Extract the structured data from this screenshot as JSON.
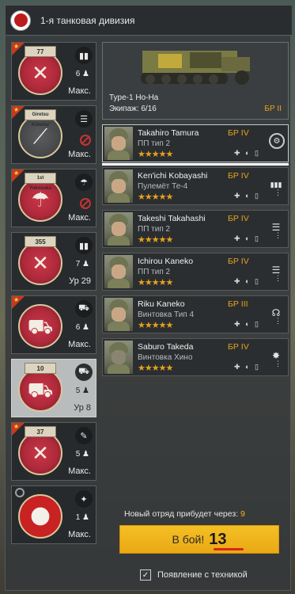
{
  "header": {
    "title": "1-я танковая дивизия"
  },
  "squads": [
    {
      "banner": "77",
      "count": "6",
      "status": "Макс.",
      "type_icon": "grenade-icon"
    },
    {
      "banner": "Giretsu Kūteitai",
      "count": "",
      "status": "Макс.",
      "type_icon": "list-icon",
      "locked": true
    },
    {
      "banner": "1st Yokosuka",
      "count": "",
      "status": "Макс.",
      "type_icon": "parachute-icon",
      "locked": true
    },
    {
      "banner": "355",
      "count": "7",
      "status": "Ур 29",
      "type_icon": "ammo-icon"
    },
    {
      "banner": "",
      "count": "6",
      "status": "Макс.",
      "type_icon": "vehicle-icon"
    },
    {
      "banner": "10",
      "count": "5",
      "status": "Ур 8",
      "type_icon": "tank-icon"
    },
    {
      "banner": "37",
      "count": "5",
      "status": "Макс.",
      "type_icon": "wrench-icon"
    },
    {
      "banner": "",
      "count": "1",
      "status": "Макс.",
      "type_icon": "grenade-launcher-icon"
    }
  ],
  "vehicle": {
    "name": "Type-1 Ho-Ha",
    "crew": "Экипаж: 6/16",
    "br": "БР II"
  },
  "soldiers": [
    {
      "name": "Takahiro Tamura",
      "weapon": "ПП тип 2",
      "br": "БР IV",
      "stars": "★★★★★",
      "abilities": "✚ ◐ ▯",
      "class_glyph": "⚙"
    },
    {
      "name": "Ken'ichi Kobayashi",
      "weapon": "Пулемёт Те-4",
      "br": "БР IV",
      "stars": "★★★★★",
      "abilities": "✚ ◐ ▯",
      "class_glyph": "▮▮▮"
    },
    {
      "name": "Takeshi Takahashi",
      "weapon": "ПП тип 2",
      "br": "БР IV",
      "stars": "★★★★★",
      "abilities": "✚ ◐ ▯",
      "class_glyph": "☰"
    },
    {
      "name": "Ichirou Kaneko",
      "weapon": "ПП тип 2",
      "br": "БР IV",
      "stars": "★★★★★",
      "abilities": "✚ ◐ ▯",
      "class_glyph": "☰"
    },
    {
      "name": "Riku Kaneko",
      "weapon": "Винтовка Тип 4",
      "br": "БР III",
      "stars": "★★★★★",
      "abilities": "✚ ◐ ▯",
      "class_glyph": "☊"
    },
    {
      "name": "Saburo Takeda",
      "weapon": "Винтовка Хино",
      "br": "БР IV",
      "stars": "★★★★★",
      "abilities": "✚ ◐ ▯",
      "class_glyph": "✸"
    }
  ],
  "footer": {
    "arrival_label": "Новый отряд прибудет через:",
    "arrival_value": "9",
    "battle_label": "В бой!",
    "battle_timer": "13",
    "spawn_label": "Появление с техникой",
    "spawn_checked": true
  },
  "colors": {
    "accent": "#e6a21d",
    "button": "#f2b420",
    "flag": "#bc1c1c"
  }
}
